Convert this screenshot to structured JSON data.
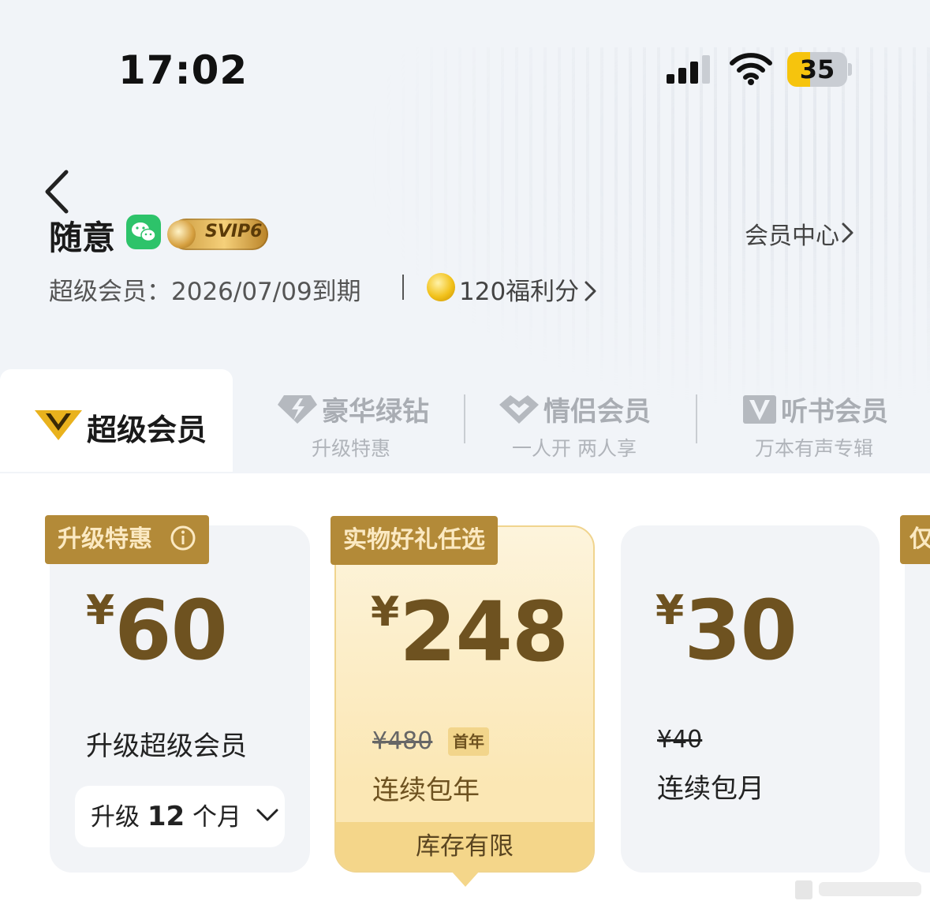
{
  "status_bar": {
    "time": "17:02",
    "battery_level": "35"
  },
  "header": {
    "username": "随意",
    "badge_text": "SVIP6",
    "member_center_label": "会员中心",
    "expiry_text": "超级会员：2026/07/09到期",
    "points_text": "120福利分"
  },
  "tabs": {
    "active": {
      "label": "超级会员"
    },
    "items": [
      {
        "title": "豪华绿钻",
        "subtitle": "升级特惠"
      },
      {
        "title": "情侣会员",
        "subtitle": "一人开 两人享"
      },
      {
        "title": "听书会员",
        "subtitle": "万本有声专辑"
      }
    ]
  },
  "cards": [
    {
      "tag": "升级特惠",
      "currency": "¥",
      "price": "60",
      "description": "升级超级会员",
      "select": {
        "prefix": "升级",
        "value": "12",
        "suffix": "个月"
      }
    },
    {
      "tag": "实物好礼任选",
      "currency": "¥",
      "price": "248",
      "original_price": "¥480",
      "badge": "首年",
      "description": "连续包年",
      "footer": "库存有限"
    },
    {
      "currency": "¥",
      "price": "30",
      "original_price": "¥40",
      "description": "连续包月"
    },
    {
      "tag": "仅"
    }
  ],
  "colors": {
    "accent_gold": "#b38a38",
    "price_brown": "#6e5220",
    "wechat_green": "#2dc36a",
    "battery_yellow": "#f6c40d"
  },
  "icons": [
    "back-icon",
    "wechat-icon",
    "svip-badge-icon",
    "coin-icon",
    "chevron-right-icon",
    "v-crown-icon",
    "lightning-diamond-icon",
    "heart-icon",
    "v-book-icon",
    "info-icon",
    "chevron-down-icon",
    "signal-icon",
    "wifi-icon",
    "battery-icon"
  ]
}
